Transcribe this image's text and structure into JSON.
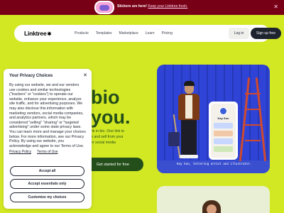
{
  "banner": {
    "text": "Stickers are here!",
    "link": "Keep your Linktree fresh.",
    "close_glyph": "✕"
  },
  "nav": {
    "logo": "Linktree",
    "logo_star": "✱",
    "links": [
      "Products",
      "Templates",
      "Marketplace",
      "Learn",
      "Pricing"
    ],
    "login": "Log in",
    "signup": "Sign up free"
  },
  "hero": {
    "line1": "bio",
    "line2": "you.",
    "sub1": "nk in bio. One link to",
    "sub2": "e and sell from your",
    "sub3": "er social media",
    "cta": "Get started for free",
    "caption": "Kay Sun, lettering artist and illustrator.",
    "phone_name": "Kay Sun"
  },
  "cookie_modal": {
    "title": "Your Privacy Choices",
    "close_glyph": "✕",
    "body": "By using our website, we and our vendors use cookies and similar technologies (\"trackers\" or \"cookies\") to operate our website, enhance your experience, analyze site traffic, and for advertising purposes. We may also disclose this information with marketing vendors, social media companies, and analytics partners, which may be considered \"selling\" \"sharing\" or \"targeted advertising\" under some state privacy laws. You can learn more and manage your choices below. For more information, see our Privacy Policy. By using our website, you acknowledge and agree to our Terms of Use.",
    "privacy_link": "Privacy Policy",
    "terms_link": "Terms of Use",
    "accept_all": "Accept all",
    "accept_essentials": "Accept essentials only",
    "customize": "Customize my choices"
  },
  "colors": {
    "background": "#d2e823",
    "banner": "#780016",
    "hero_text": "#254f1a",
    "hero_image_bg": "#2f44d6",
    "dark": "#1e2330"
  }
}
